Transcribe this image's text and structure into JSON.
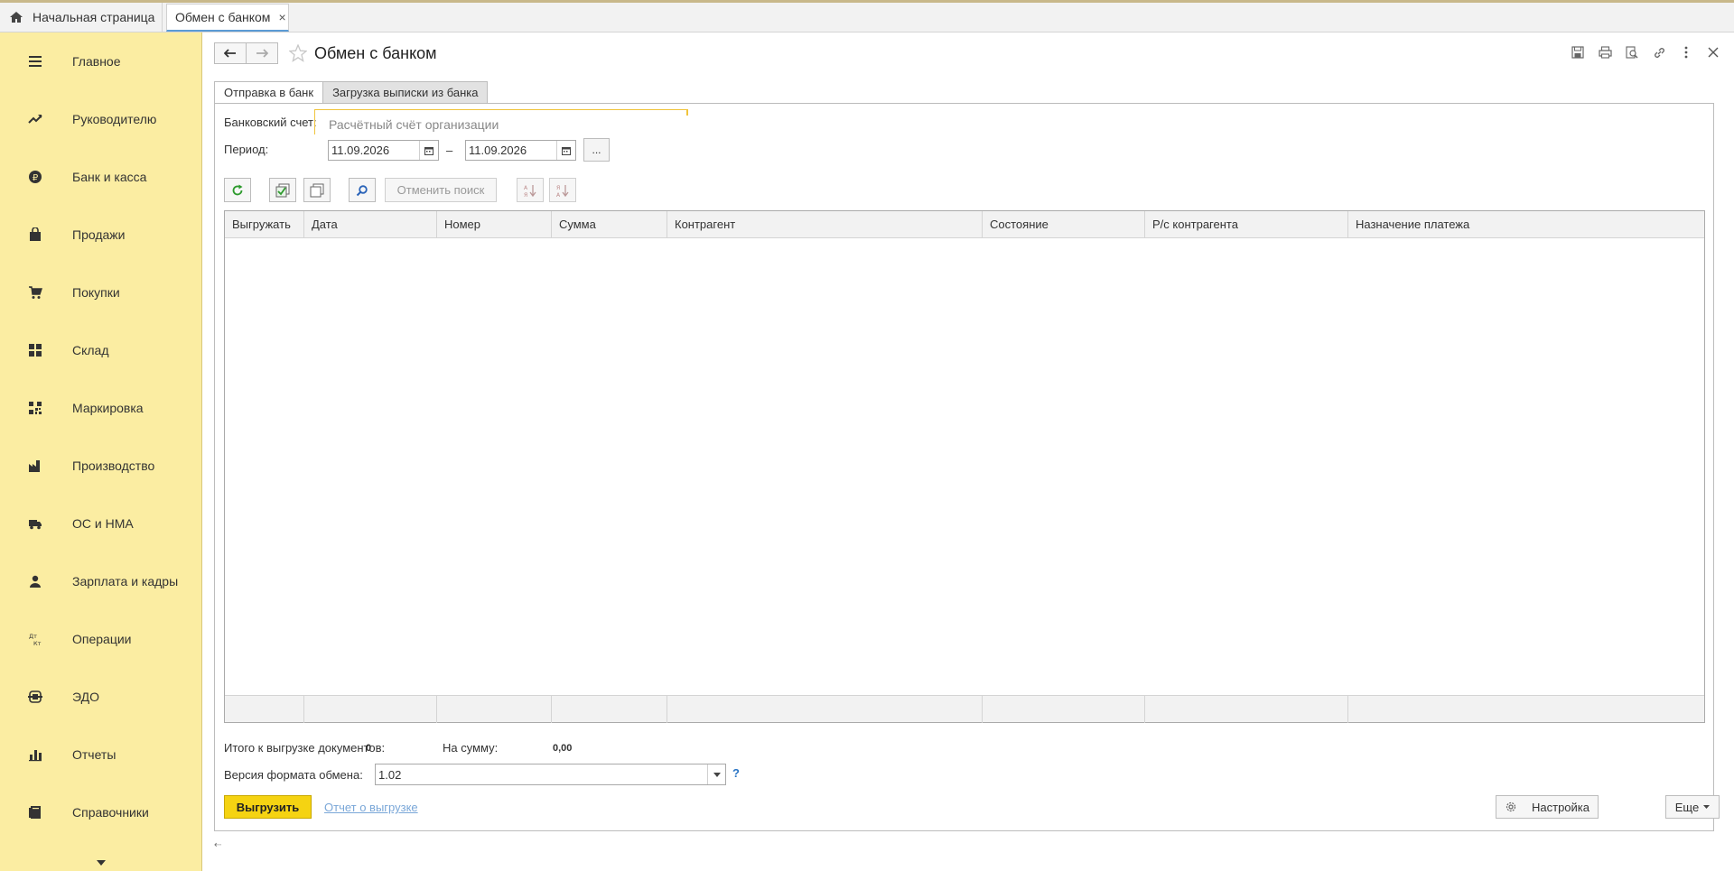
{
  "tabs": {
    "home_label": "Начальная страница",
    "active_label": "Обмен с банком",
    "close_glyph": "×"
  },
  "sidebar": {
    "items": [
      {
        "label": "Главное",
        "icon": "menu-lines-icon"
      },
      {
        "label": "Руководителю",
        "icon": "trend-up-icon"
      },
      {
        "label": "Банк и касса",
        "icon": "ruble-coin-icon"
      },
      {
        "label": "Продажи",
        "icon": "shopping-bag-icon"
      },
      {
        "label": "Покупки",
        "icon": "cart-icon"
      },
      {
        "label": "Склад",
        "icon": "warehouse-grid-icon"
      },
      {
        "label": "Маркировка",
        "icon": "qr-code-icon"
      },
      {
        "label": "Производство",
        "icon": "factory-icon"
      },
      {
        "label": "ОС и НМА",
        "icon": "truck-icon"
      },
      {
        "label": "Зарплата и кадры",
        "icon": "person-icon"
      },
      {
        "label": "Операции",
        "icon": "debit-credit-icon"
      },
      {
        "label": "ЭДО",
        "icon": "edo-exchange-icon"
      },
      {
        "label": "Отчеты",
        "icon": "bar-chart-icon"
      },
      {
        "label": "Справочники",
        "icon": "book-icon"
      }
    ]
  },
  "header": {
    "title": "Обмен с банком"
  },
  "form_tabs": {
    "send": "Отправка в банк",
    "load": "Загрузка выписки из банка"
  },
  "fields": {
    "bank_account_label": "Банковский счет:",
    "bank_account_placeholder": "Расчётный счёт организации",
    "period_label": "Период:",
    "date_from": "11.09.2026",
    "date_dash": "–",
    "date_to": "11.09.2026",
    "dots": "..."
  },
  "toolbar": {
    "cancel_search": "Отменить поиск"
  },
  "grid": {
    "columns": [
      "Выгружать",
      "Дата",
      "Номер",
      "Сумма",
      "Контрагент",
      "Состояние",
      "Р/с контрагента",
      "Назначение платежа"
    ],
    "rows": []
  },
  "totals": {
    "docs_label": "Итого к выгрузке документов:",
    "docs_value": "0",
    "sum_label": "На сумму:",
    "sum_value": "0,00"
  },
  "format": {
    "label": "Версия формата обмена:",
    "value": "1.02",
    "help": "?"
  },
  "footer": {
    "upload_button": "Выгрузить",
    "report_link": "Отчет о выгрузке",
    "settings_button": "Настройка",
    "more_button": "Еще"
  },
  "colors": {
    "sidebar_bg": "#fbeda2",
    "primary_button": "#f5d312",
    "focus_border": "#f0c43c",
    "link": "#7aa7d8"
  }
}
